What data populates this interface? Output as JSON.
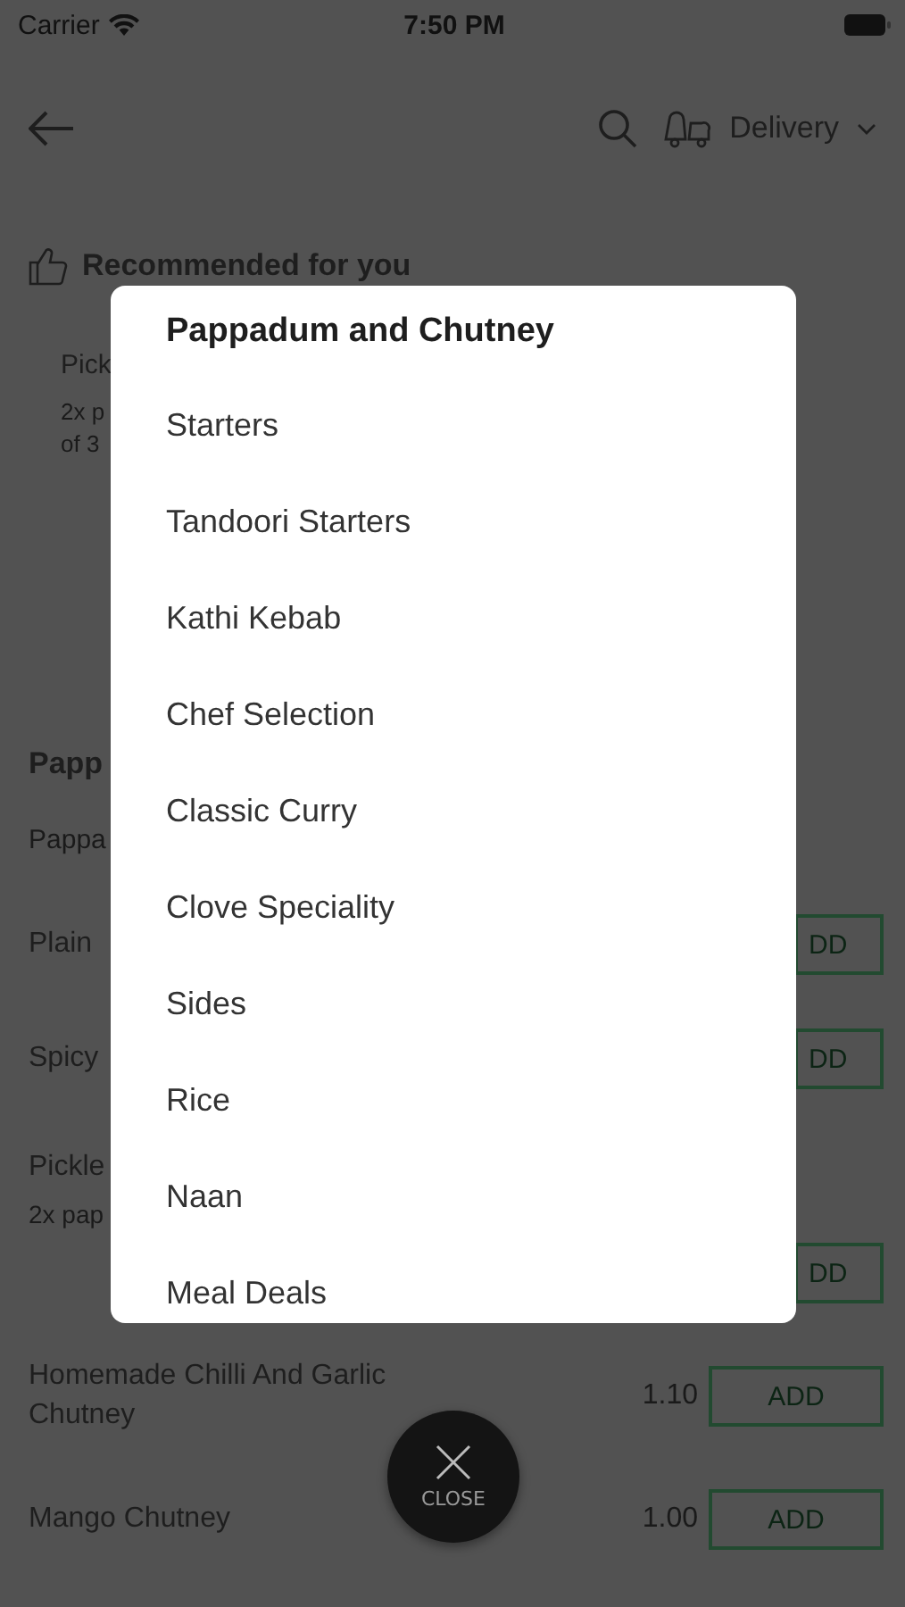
{
  "status_bar": {
    "carrier": "Carrier",
    "time": "7:50 PM"
  },
  "header": {
    "delivery_label": "Delivery"
  },
  "recommended": {
    "title": "Recommended for you",
    "card": {
      "name": "Pick",
      "description_lines": [
        "2x p",
        "of 3"
      ]
    }
  },
  "section": {
    "title": "Papp",
    "subtitle": "Pappa"
  },
  "menu_items": [
    {
      "name": "Plain",
      "button": "DD"
    },
    {
      "name": "Spicy",
      "button": "DD"
    },
    {
      "name": "Pickle",
      "description": "2x pap",
      "button": "DD"
    },
    {
      "name": "Homemade Chilli And Garlic Chutney",
      "price": "1.10",
      "button": "ADD"
    },
    {
      "name": "Mango Chutney",
      "price": "1.00",
      "button": "ADD"
    }
  ],
  "category_menu": {
    "items": [
      {
        "label": "Pappadum and Chutney",
        "selected": true
      },
      {
        "label": "Starters",
        "selected": false
      },
      {
        "label": "Tandoori Starters",
        "selected": false
      },
      {
        "label": "Kathi Kebab",
        "selected": false
      },
      {
        "label": "Chef Selection",
        "selected": false
      },
      {
        "label": "Classic Curry",
        "selected": false
      },
      {
        "label": "Clove Speciality",
        "selected": false
      },
      {
        "label": "Sides",
        "selected": false
      },
      {
        "label": "Rice",
        "selected": false
      },
      {
        "label": "Naan",
        "selected": false
      },
      {
        "label": "Meal Deals",
        "selected": false
      }
    ]
  },
  "close_button": {
    "label": "CLOSE"
  }
}
